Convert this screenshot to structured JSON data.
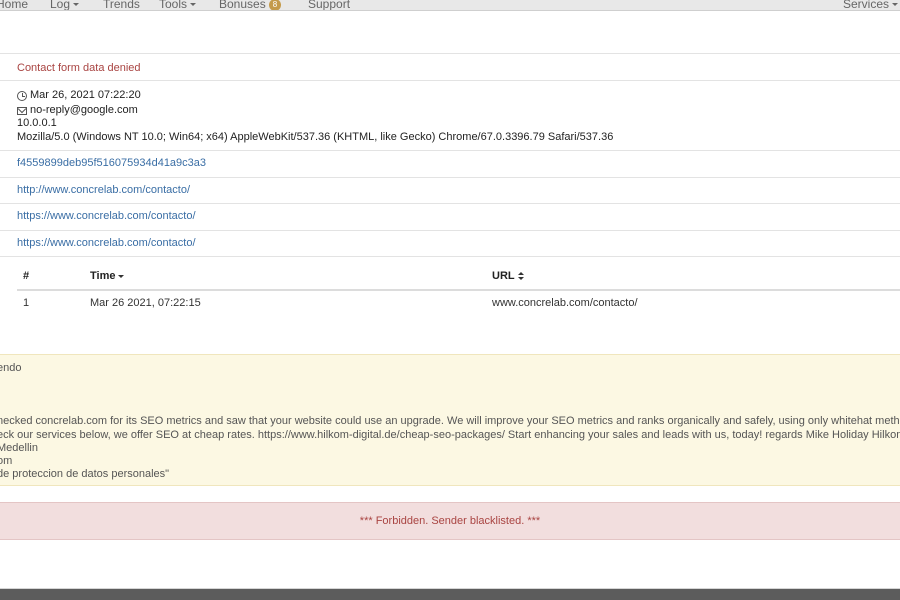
{
  "nav": {
    "items": [
      "Home",
      "Log",
      "Trends",
      "Tools",
      "Bonuses",
      "Support"
    ],
    "bonuses_badge": "8",
    "right": "Services"
  },
  "submission": {
    "status": "Contact form data denied",
    "timestamp": "Mar 26, 2021 07:22:20",
    "email": "no-reply@google.com",
    "ip": "10.0.0.1",
    "user_agent": "Mozilla/5.0 (Windows NT 10.0; Win64; x64) AppleWebKit/537.36 (KHTML, like Gecko) Chrome/67.0.3396.79 Safari/537.36",
    "hash": "f4559899deb95f516075934d41a9c3a3",
    "url1": "http://www.concrelab.com/contacto/",
    "url2": "https://www.concrelab.com/contacto/",
    "url3": "https://www.concrelab.com/contacto/"
  },
  "visits_table": {
    "headers": [
      "#",
      "Time",
      "URL"
    ],
    "rows": [
      [
        "1",
        "Mar 26 2021, 07:22:15",
        "www.concrelab.com/contacto/"
      ]
    ]
  },
  "message": {
    "lines": [
      "endo",
      "necked concrelab.com for its SEO metrics and saw that your website could use an upgrade. We will improve your SEO metrics and ranks organically and safely, using only whitehat methods, while providing monthly re",
      "eck our services below, we offer SEO at cheap rates. https://www.hilkom-digital.de/cheap-seo-packages/ Start enhancing your sales and leads with us, today! regards Mike Holiday Hilkom Digital Team support@hilko",
      "Medellin",
      "om",
      " de proteccion de datos personales\""
    ]
  },
  "alert": {
    "text": "*** Forbidden. Sender blacklisted. ***"
  }
}
